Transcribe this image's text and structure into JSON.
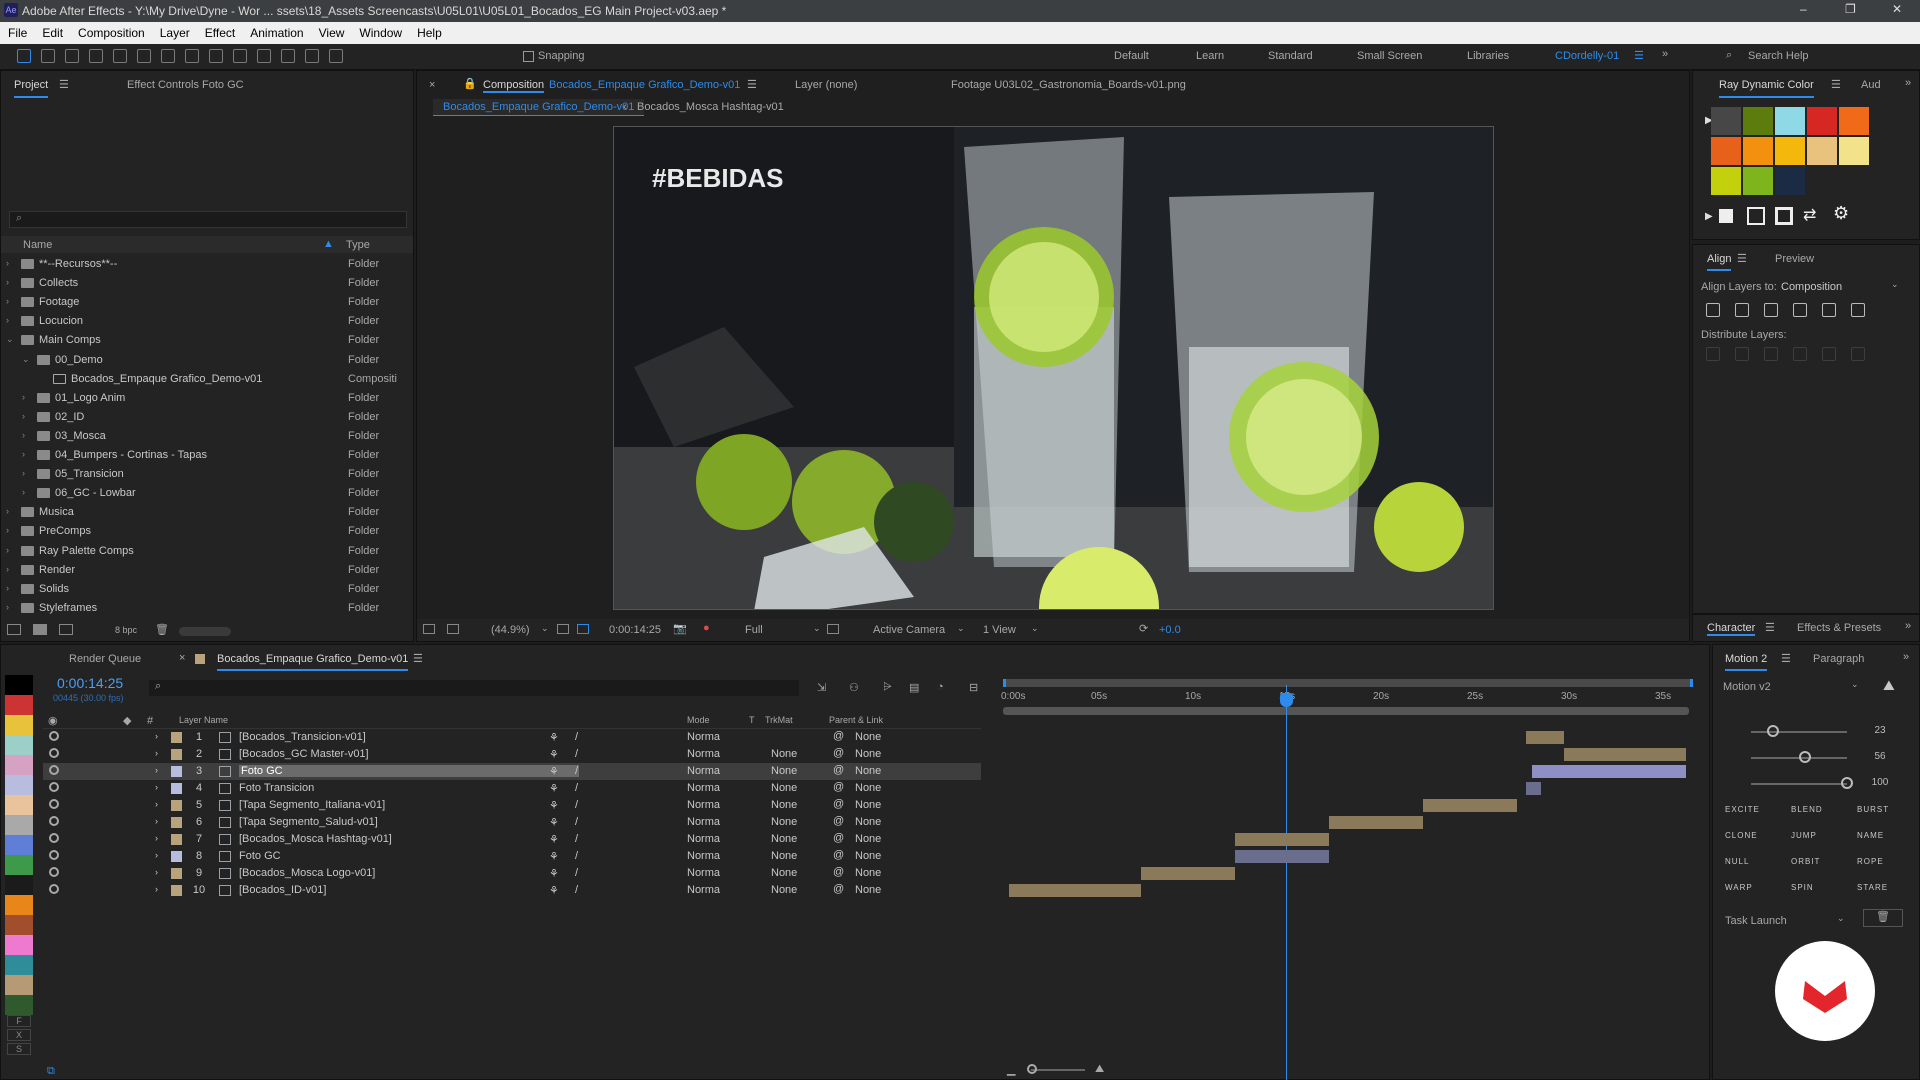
{
  "window": {
    "title": "Adobe After Effects - Y:\\My Drive\\Dyne - Wor ... ssets\\18_Assets Screencasts\\U05L01\\U05L01_Bocados_EG Main Project-v03.aep *"
  },
  "menu": [
    "File",
    "Edit",
    "Composition",
    "Layer",
    "Effect",
    "Animation",
    "View",
    "Window",
    "Help"
  ],
  "toolbar": {
    "snapping": "Snapping",
    "search_placeholder": "Search Help"
  },
  "workspaces": [
    "Default",
    "Learn",
    "Standard",
    "Small Screen",
    "Libraries",
    "CDordelly-01"
  ],
  "project": {
    "tab": "Project",
    "effect_controls": "Effect Controls Foto GC",
    "col_name": "Name",
    "col_type": "Type",
    "bpc": "8 bpc",
    "items": [
      {
        "name": "**--Recursos**--",
        "type": "Folder"
      },
      {
        "name": "Collects",
        "type": "Folder"
      },
      {
        "name": "Footage",
        "type": "Folder"
      },
      {
        "name": "Locucion",
        "type": "Folder"
      },
      {
        "name": "Main Comps",
        "type": "Folder"
      },
      {
        "name": "00_Demo",
        "type": "Folder"
      },
      {
        "name": "Bocados_Empaque Grafico_Demo-v01",
        "type": "Compositi"
      },
      {
        "name": "01_Logo Anim",
        "type": "Folder"
      },
      {
        "name": "02_ID",
        "type": "Folder"
      },
      {
        "name": "03_Mosca",
        "type": "Folder"
      },
      {
        "name": "04_Bumpers - Cortinas - Tapas",
        "type": "Folder"
      },
      {
        "name": "05_Transicion",
        "type": "Folder"
      },
      {
        "name": "06_GC - Lowbar",
        "type": "Folder"
      },
      {
        "name": "Musica",
        "type": "Folder"
      },
      {
        "name": "PreComps",
        "type": "Folder"
      },
      {
        "name": "Ray Palette Comps",
        "type": "Folder"
      },
      {
        "name": "Render",
        "type": "Folder"
      },
      {
        "name": "Solids",
        "type": "Folder"
      },
      {
        "name": "Styleframes",
        "type": "Folder"
      }
    ]
  },
  "comp": {
    "tab_prefix": "Composition",
    "tab_name": "Bocados_Empaque Grafico_Demo-v01",
    "layer_tab": "Layer (none)",
    "footage_tab": "Footage U03L02_Gastronomia_Boards-v01.png",
    "crumb1": "Bocados_Empaque Grafico_Demo-v01",
    "crumb2": "Bocados_Mosca Hashtag-v01",
    "overlay": "#BEBIDAS",
    "zoom": "(44.9%)",
    "time": "0:00:14:25",
    "res": "Full",
    "camera": "Active Camera",
    "views": "1 View",
    "exposure": "+0.0"
  },
  "timeline": {
    "render_queue": "Render Queue",
    "tab": "Bocados_Empaque Grafico_Demo-v01",
    "timecode": "0:00:14:25",
    "frames": "00445 (30.00 fps)",
    "col_layer": "Layer Name",
    "col_mode": "Mode",
    "col_t": "T",
    "col_trk": "TrkMat",
    "col_parent": "Parent & Link",
    "ticks": [
      "0:00s",
      "05s",
      "10s",
      "15s",
      "20s",
      "25s",
      "30s",
      "35s"
    ],
    "layers": [
      {
        "num": "1",
        "name": "[Bocados_Transicion-v01]",
        "mode": "Norma",
        "trk": "",
        "parent": "None"
      },
      {
        "num": "2",
        "name": "[Bocados_GC Master-v01]",
        "mode": "Norma",
        "trk": "None",
        "parent": "None"
      },
      {
        "num": "3",
        "name": "Foto GC",
        "mode": "Norma",
        "trk": "None",
        "parent": "None"
      },
      {
        "num": "4",
        "name": "Foto Transicion",
        "mode": "Norma",
        "trk": "None",
        "parent": "None"
      },
      {
        "num": "5",
        "name": "[Tapa Segmento_Italiana-v01]",
        "mode": "Norma",
        "trk": "None",
        "parent": "None"
      },
      {
        "num": "6",
        "name": "[Tapa Segmento_Salud-v01]",
        "mode": "Norma",
        "trk": "None",
        "parent": "None"
      },
      {
        "num": "7",
        "name": "[Bocados_Mosca Hashtag-v01]",
        "mode": "Norma",
        "trk": "None",
        "parent": "None"
      },
      {
        "num": "8",
        "name": "Foto GC",
        "mode": "Norma",
        "trk": "None",
        "parent": "None"
      },
      {
        "num": "9",
        "name": "[Bocados_Mosca Logo-v01]",
        "mode": "Norma",
        "trk": "None",
        "parent": "None"
      },
      {
        "num": "10",
        "name": "[Bocados_ID-v01]",
        "mode": "Norma",
        "trk": "None",
        "parent": "None"
      }
    ]
  },
  "right": {
    "ray_tab": "Ray Dynamic Color",
    "aud_tab": "Aud",
    "align_tab": "Align",
    "preview_tab": "Preview",
    "align_to_label": "Align Layers to:",
    "align_to": "Composition",
    "distribute": "Distribute Layers:",
    "character_tab": "Character",
    "effects_tab": "Effects & Presets",
    "motion_tab": "Motion 2",
    "paragraph_tab": "Paragraph",
    "motion_select": "Motion v2",
    "slider_vals": [
      "23",
      "56",
      "100"
    ],
    "buttons": [
      "EXCITE",
      "BLEND",
      "BURST",
      "CLONE",
      "JUMP",
      "NAME",
      "NULL",
      "ORBIT",
      "ROPE",
      "WARP",
      "SPIN",
      "STARE"
    ],
    "task": "Task Launch"
  },
  "colors": {
    "accent": "#2d8ceb",
    "timecode": "#4a9ff5"
  }
}
